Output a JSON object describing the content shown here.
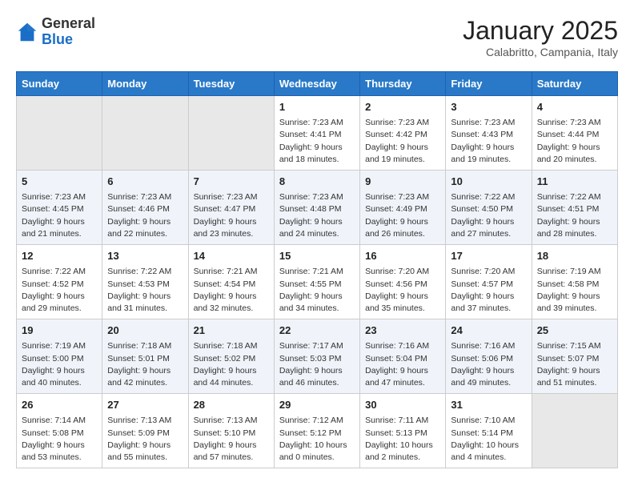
{
  "header": {
    "logo_general": "General",
    "logo_blue": "Blue",
    "month_year": "January 2025",
    "location": "Calabritto, Campania, Italy"
  },
  "days_of_week": [
    "Sunday",
    "Monday",
    "Tuesday",
    "Wednesday",
    "Thursday",
    "Friday",
    "Saturday"
  ],
  "weeks": [
    [
      {
        "day": "",
        "info": ""
      },
      {
        "day": "",
        "info": ""
      },
      {
        "day": "",
        "info": ""
      },
      {
        "day": "1",
        "info": "Sunrise: 7:23 AM\nSunset: 4:41 PM\nDaylight: 9 hours\nand 18 minutes."
      },
      {
        "day": "2",
        "info": "Sunrise: 7:23 AM\nSunset: 4:42 PM\nDaylight: 9 hours\nand 19 minutes."
      },
      {
        "day": "3",
        "info": "Sunrise: 7:23 AM\nSunset: 4:43 PM\nDaylight: 9 hours\nand 19 minutes."
      },
      {
        "day": "4",
        "info": "Sunrise: 7:23 AM\nSunset: 4:44 PM\nDaylight: 9 hours\nand 20 minutes."
      }
    ],
    [
      {
        "day": "5",
        "info": "Sunrise: 7:23 AM\nSunset: 4:45 PM\nDaylight: 9 hours\nand 21 minutes."
      },
      {
        "day": "6",
        "info": "Sunrise: 7:23 AM\nSunset: 4:46 PM\nDaylight: 9 hours\nand 22 minutes."
      },
      {
        "day": "7",
        "info": "Sunrise: 7:23 AM\nSunset: 4:47 PM\nDaylight: 9 hours\nand 23 minutes."
      },
      {
        "day": "8",
        "info": "Sunrise: 7:23 AM\nSunset: 4:48 PM\nDaylight: 9 hours\nand 24 minutes."
      },
      {
        "day": "9",
        "info": "Sunrise: 7:23 AM\nSunset: 4:49 PM\nDaylight: 9 hours\nand 26 minutes."
      },
      {
        "day": "10",
        "info": "Sunrise: 7:22 AM\nSunset: 4:50 PM\nDaylight: 9 hours\nand 27 minutes."
      },
      {
        "day": "11",
        "info": "Sunrise: 7:22 AM\nSunset: 4:51 PM\nDaylight: 9 hours\nand 28 minutes."
      }
    ],
    [
      {
        "day": "12",
        "info": "Sunrise: 7:22 AM\nSunset: 4:52 PM\nDaylight: 9 hours\nand 29 minutes."
      },
      {
        "day": "13",
        "info": "Sunrise: 7:22 AM\nSunset: 4:53 PM\nDaylight: 9 hours\nand 31 minutes."
      },
      {
        "day": "14",
        "info": "Sunrise: 7:21 AM\nSunset: 4:54 PM\nDaylight: 9 hours\nand 32 minutes."
      },
      {
        "day": "15",
        "info": "Sunrise: 7:21 AM\nSunset: 4:55 PM\nDaylight: 9 hours\nand 34 minutes."
      },
      {
        "day": "16",
        "info": "Sunrise: 7:20 AM\nSunset: 4:56 PM\nDaylight: 9 hours\nand 35 minutes."
      },
      {
        "day": "17",
        "info": "Sunrise: 7:20 AM\nSunset: 4:57 PM\nDaylight: 9 hours\nand 37 minutes."
      },
      {
        "day": "18",
        "info": "Sunrise: 7:19 AM\nSunset: 4:58 PM\nDaylight: 9 hours\nand 39 minutes."
      }
    ],
    [
      {
        "day": "19",
        "info": "Sunrise: 7:19 AM\nSunset: 5:00 PM\nDaylight: 9 hours\nand 40 minutes."
      },
      {
        "day": "20",
        "info": "Sunrise: 7:18 AM\nSunset: 5:01 PM\nDaylight: 9 hours\nand 42 minutes."
      },
      {
        "day": "21",
        "info": "Sunrise: 7:18 AM\nSunset: 5:02 PM\nDaylight: 9 hours\nand 44 minutes."
      },
      {
        "day": "22",
        "info": "Sunrise: 7:17 AM\nSunset: 5:03 PM\nDaylight: 9 hours\nand 46 minutes."
      },
      {
        "day": "23",
        "info": "Sunrise: 7:16 AM\nSunset: 5:04 PM\nDaylight: 9 hours\nand 47 minutes."
      },
      {
        "day": "24",
        "info": "Sunrise: 7:16 AM\nSunset: 5:06 PM\nDaylight: 9 hours\nand 49 minutes."
      },
      {
        "day": "25",
        "info": "Sunrise: 7:15 AM\nSunset: 5:07 PM\nDaylight: 9 hours\nand 51 minutes."
      }
    ],
    [
      {
        "day": "26",
        "info": "Sunrise: 7:14 AM\nSunset: 5:08 PM\nDaylight: 9 hours\nand 53 minutes."
      },
      {
        "day": "27",
        "info": "Sunrise: 7:13 AM\nSunset: 5:09 PM\nDaylight: 9 hours\nand 55 minutes."
      },
      {
        "day": "28",
        "info": "Sunrise: 7:13 AM\nSunset: 5:10 PM\nDaylight: 9 hours\nand 57 minutes."
      },
      {
        "day": "29",
        "info": "Sunrise: 7:12 AM\nSunset: 5:12 PM\nDaylight: 10 hours\nand 0 minutes."
      },
      {
        "day": "30",
        "info": "Sunrise: 7:11 AM\nSunset: 5:13 PM\nDaylight: 10 hours\nand 2 minutes."
      },
      {
        "day": "31",
        "info": "Sunrise: 7:10 AM\nSunset: 5:14 PM\nDaylight: 10 hours\nand 4 minutes."
      },
      {
        "day": "",
        "info": ""
      }
    ]
  ]
}
